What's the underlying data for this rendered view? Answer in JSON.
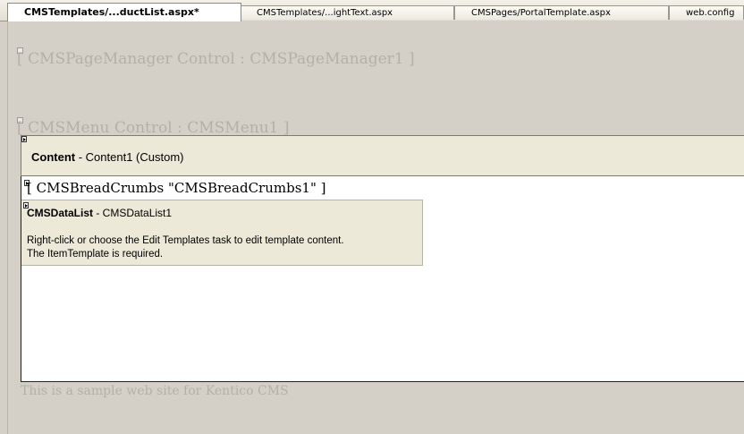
{
  "tabs": [
    {
      "label": "CMSTemplates/...ductList.aspx*",
      "active": true
    },
    {
      "label": "CMSTemplates/...ightText.aspx",
      "active": false
    },
    {
      "label": "CMSPages/PortalTemplate.aspx",
      "active": false
    },
    {
      "label": "web.config",
      "active": false
    }
  ],
  "designer": {
    "page_manager_label": "[ CMSPageManager Control : CMSPageManager1 ]",
    "menu_label": "[ CMSMenu Control : CMSMenu1 ]",
    "content": {
      "title_bold": "Content",
      "title_rest": " - Content1 (Custom)"
    },
    "breadcrumbs": "[ CMSBreadCrumbs \"CMSBreadCrumbs1\" ]",
    "datalist": {
      "title_bold": "CMSDataList",
      "title_rest": " - CMSDataList1",
      "message_line1": "Right-click or choose the Edit Templates task to edit template content.",
      "message_line2": "The ItemTemplate is required."
    },
    "footer_text": "This is a sample web site for Kentico CMS"
  }
}
